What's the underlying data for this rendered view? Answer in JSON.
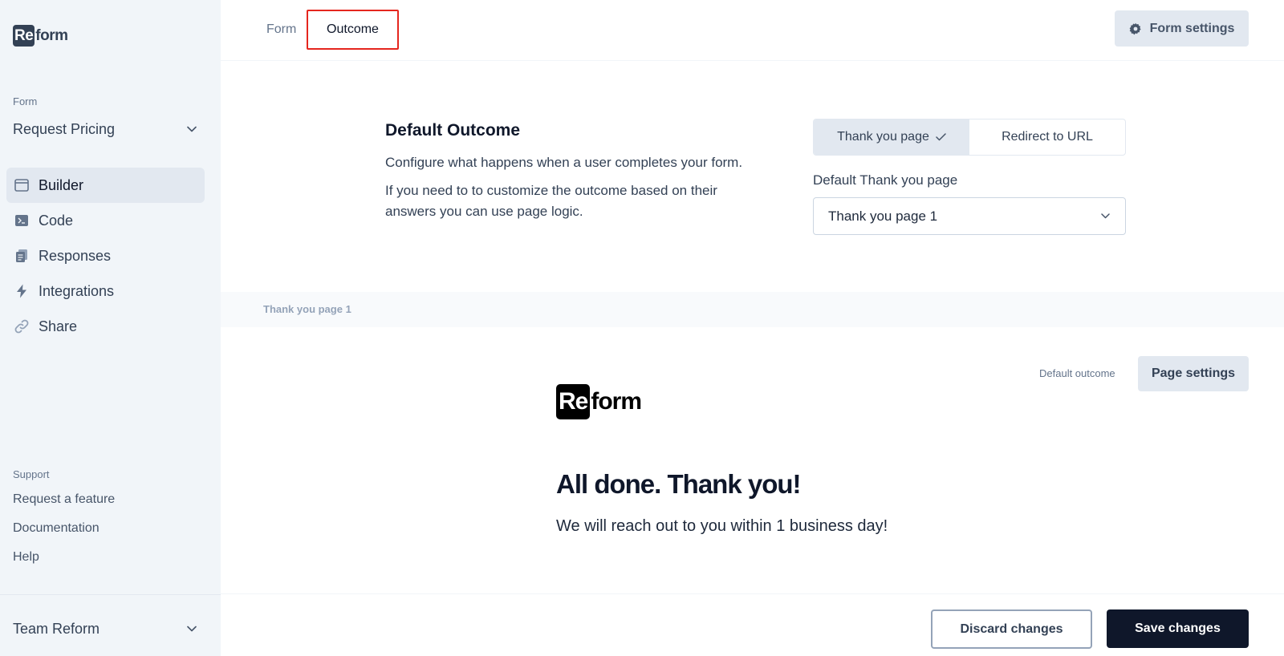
{
  "app": {
    "logo_box": "Re",
    "logo_text": "form"
  },
  "sidebar": {
    "form_section_label": "Form",
    "form_name": "Request Pricing",
    "items": [
      {
        "label": "Builder",
        "icon": "window-icon",
        "active": true
      },
      {
        "label": "Code",
        "icon": "terminal-icon",
        "active": false
      },
      {
        "label": "Responses",
        "icon": "documents-icon",
        "active": false
      },
      {
        "label": "Integrations",
        "icon": "lightning-icon",
        "active": false
      },
      {
        "label": "Share",
        "icon": "link-icon",
        "active": false
      }
    ],
    "support_label": "Support",
    "support_links": [
      "Request a feature",
      "Documentation",
      "Help"
    ],
    "team_name": "Team Reform"
  },
  "header": {
    "tabs": [
      {
        "label": "Form",
        "active": false
      },
      {
        "label": "Outcome",
        "active": true
      }
    ],
    "form_settings_label": "Form settings"
  },
  "outcome": {
    "title": "Default Outcome",
    "desc1": "Configure what happens when a user completes your form.",
    "desc2": "If you need to to customize the outcome based on their answers you can use page logic.",
    "options": [
      {
        "label": "Thank you page",
        "selected": true
      },
      {
        "label": "Redirect to URL",
        "selected": false
      }
    ],
    "default_page_label": "Default Thank you page",
    "default_page_value": "Thank you page 1"
  },
  "page_preview": {
    "band_label": "Thank you page 1",
    "default_outcome_label": "Default outcome",
    "page_settings_label": "Page settings",
    "logo_box": "Re",
    "logo_text": "form",
    "title": "All done. Thank you!",
    "subtitle": "We will reach out to you within 1 business day!"
  },
  "footer": {
    "discard_label": "Discard changes",
    "save_label": "Save changes"
  },
  "colors": {
    "sidebar_bg": "#f1f5f9",
    "active_item_bg": "#e2e8f0",
    "primary_button": "#0f172a",
    "tab_highlight": "#e5261e"
  }
}
